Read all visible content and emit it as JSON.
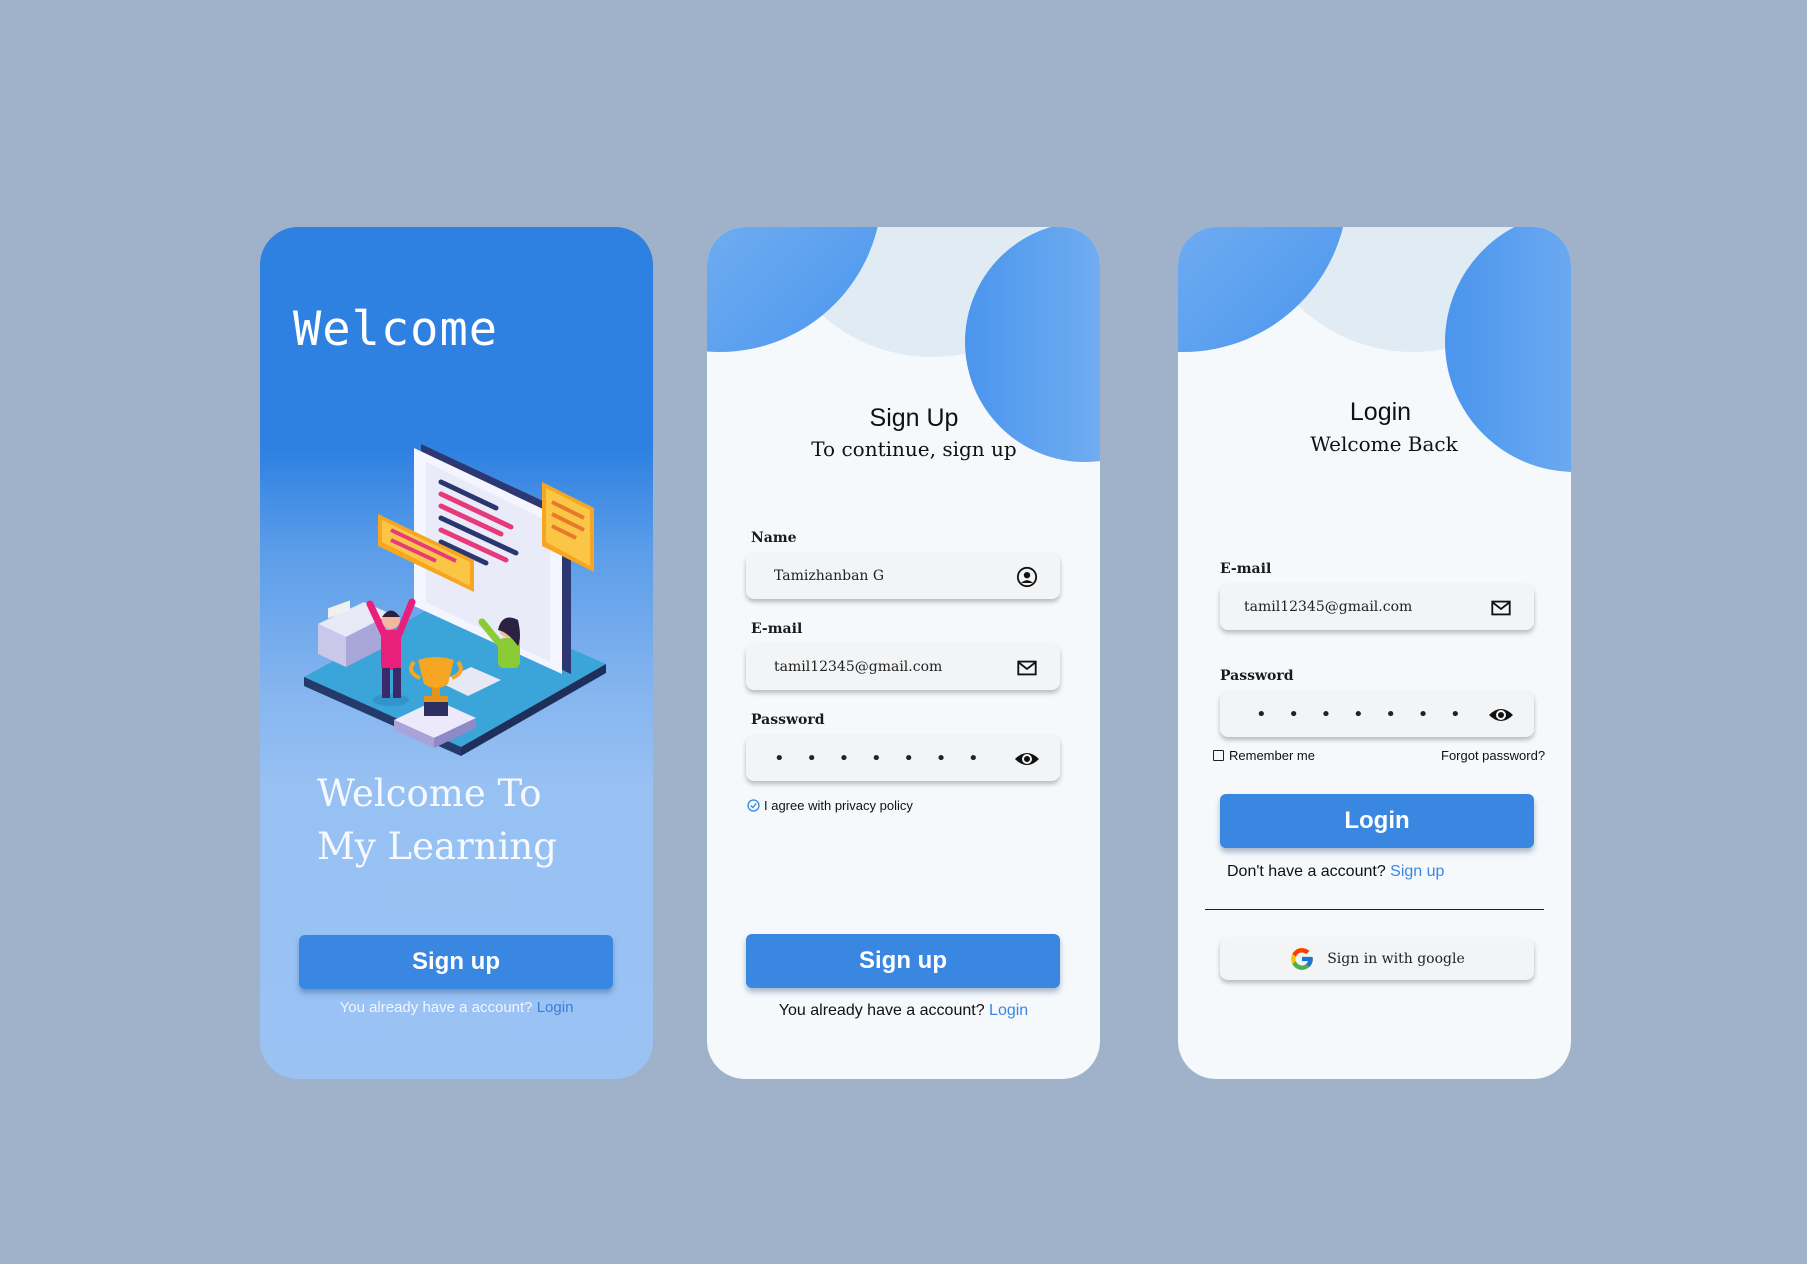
{
  "welcome_screen": {
    "title": "Welcome",
    "tagline_line1": "Welcome To",
    "tagline_line2": "My Learning",
    "signup_button": "Sign up",
    "account_prompt": "You already have a account?",
    "login_link": "Login"
  },
  "signup_screen": {
    "heading": "Sign Up",
    "subheading": "To continue, sign up",
    "name": {
      "label": "Name",
      "value": "Tamizhanban G",
      "icon": "user-circle-icon"
    },
    "email": {
      "label": "E-mail",
      "value": "tamil12345@gmail.com",
      "icon": "mail-icon"
    },
    "password": {
      "label": "Password",
      "value": "• • • • • • • •",
      "icon": "eye-icon"
    },
    "privacy_text": "I agree with privacy policy",
    "signup_button": "Sign up",
    "account_prompt": "You already have a account?",
    "login_link": "Login"
  },
  "login_screen": {
    "heading": "Login",
    "subheading": "Welcome Back",
    "email": {
      "label": "E-mail",
      "value": "tamil12345@gmail.com",
      "icon": "mail-icon"
    },
    "password": {
      "label": "Password",
      "value": "• • • • • • • •",
      "icon": "eye-icon"
    },
    "remember_me": "Remember me",
    "forgot_password": "Forgot password?",
    "login_button": "Login",
    "no_account_prompt": "Don't have a account?",
    "signup_link": "Sign up",
    "google_button": "Sign in with google"
  },
  "colors": {
    "background": "#9fb2c9",
    "accent": "#3a87e2",
    "blob_blue": "#5a9ef0",
    "blob_pale": "#e3edf5",
    "card": "#f5f9fc"
  }
}
